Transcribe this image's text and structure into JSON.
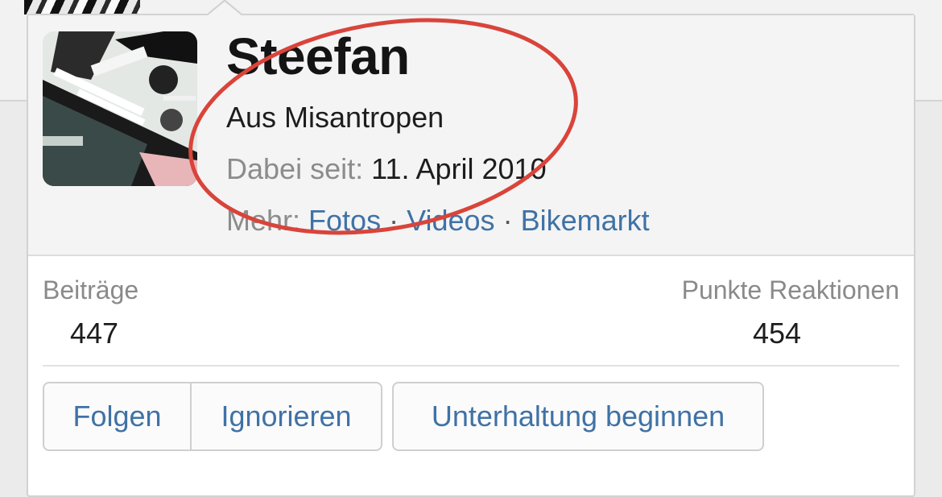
{
  "profile": {
    "name": "Steefan",
    "user_title": "Aus Misantropen",
    "joined_label": "Dabei seit:",
    "joined_date": "11. April 2010",
    "more_label": "Mehr:",
    "links": {
      "photos": "Fotos",
      "videos": "Videos",
      "bike_market": "Bikemarkt"
    },
    "separator": "·"
  },
  "stats": {
    "posts_label": "Beiträge",
    "posts_value": "447",
    "reactions_label": "Punkte Reaktionen",
    "reactions_value": "454"
  },
  "actions": {
    "follow": "Folgen",
    "ignore": "Ignorieren",
    "start_conversation": "Unterhaltung beginnen"
  },
  "colors": {
    "link": "#3f72a6",
    "annotation": "#d9443a",
    "muted_text": "#8c8c8c"
  }
}
